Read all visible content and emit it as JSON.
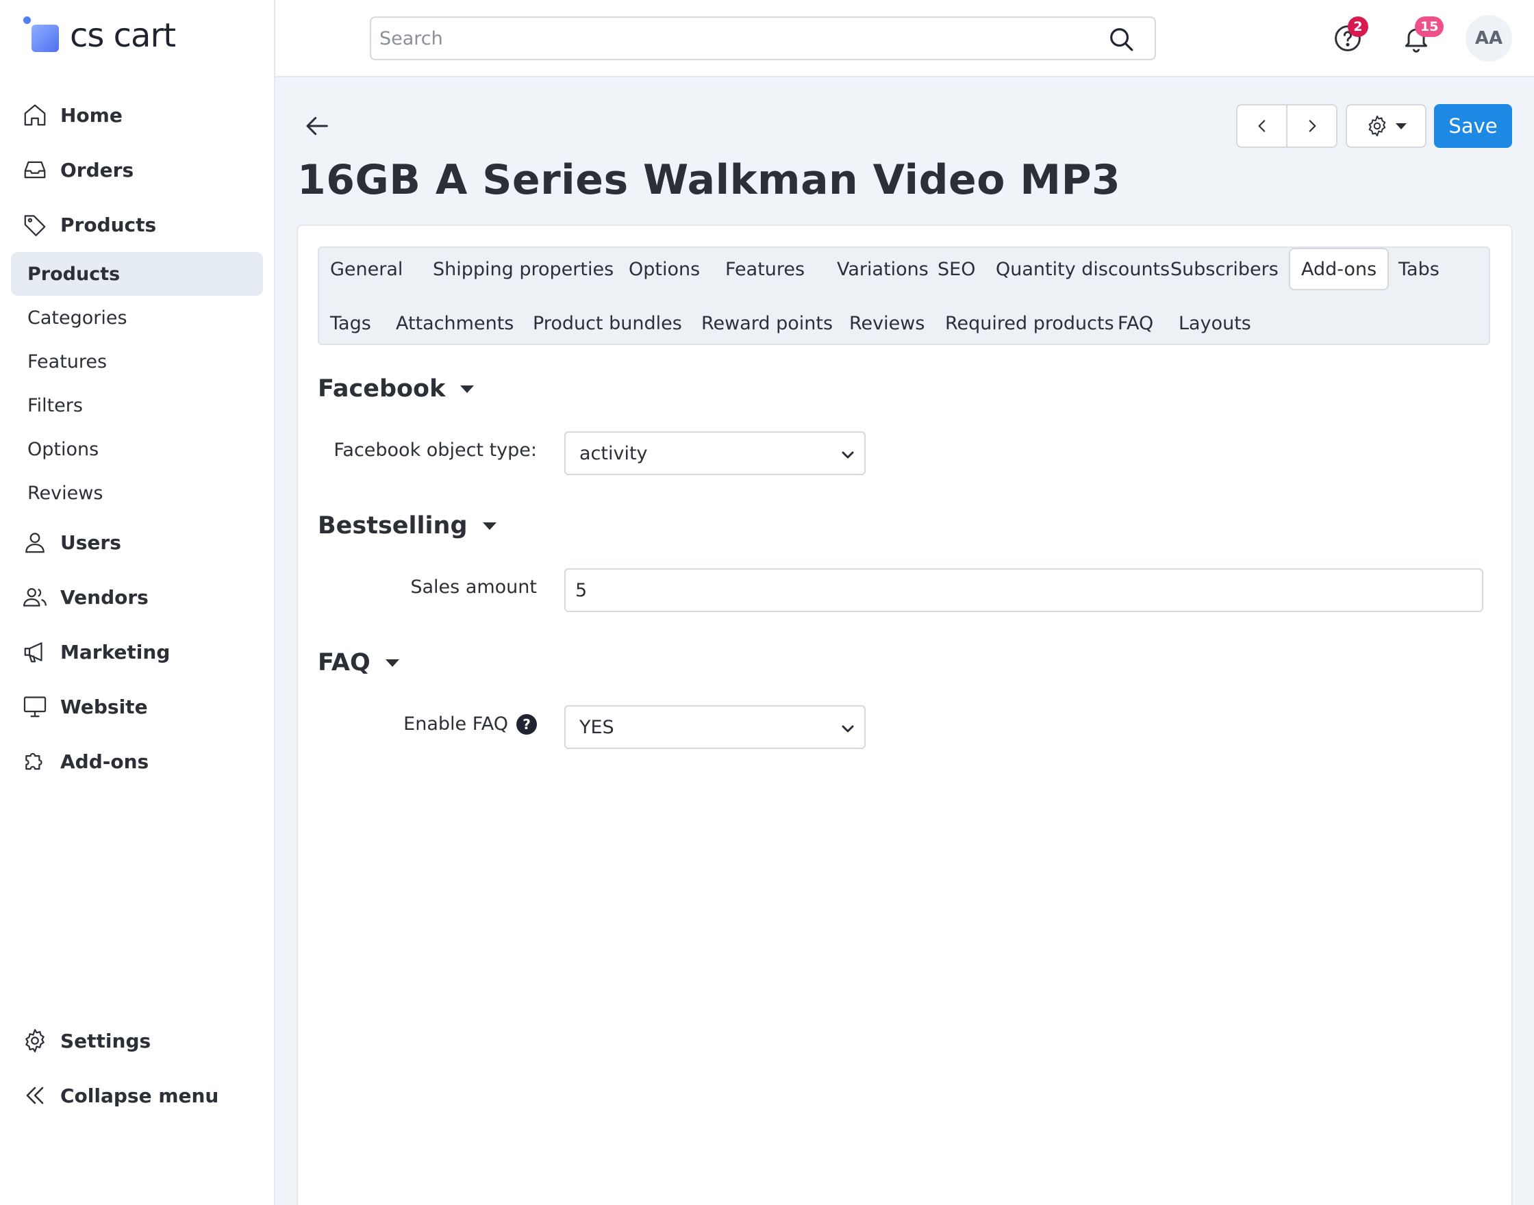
{
  "brand": {
    "name": "cs cart"
  },
  "sidebar": {
    "items": [
      {
        "label": "Home",
        "icon": "home-icon"
      },
      {
        "label": "Orders",
        "icon": "inbox-icon"
      },
      {
        "label": "Products",
        "icon": "tag-icon"
      },
      {
        "label": "Users",
        "icon": "user-icon"
      },
      {
        "label": "Vendors",
        "icon": "users-icon"
      },
      {
        "label": "Marketing",
        "icon": "megaphone-icon"
      },
      {
        "label": "Website",
        "icon": "monitor-icon"
      },
      {
        "label": "Add-ons",
        "icon": "puzzle-icon"
      }
    ],
    "products_sub": [
      "Products",
      "Categories",
      "Features",
      "Filters",
      "Options",
      "Reviews"
    ],
    "active_sub": "Products",
    "footer": [
      {
        "label": "Settings",
        "icon": "gear-icon"
      },
      {
        "label": "Collapse menu",
        "icon": "double-chevron-left-icon"
      }
    ]
  },
  "header": {
    "search_placeholder": "Search",
    "help_badge": "2",
    "notifications_badge": "15",
    "avatar_initials": "AA"
  },
  "toolbar": {
    "save_label": "Save"
  },
  "page": {
    "title": "16GB A Series Walkman Video MP3"
  },
  "tabs": {
    "row1": [
      "General",
      "Shipping properties",
      "Options",
      "Features",
      "Variations",
      "SEO",
      "Quantity discounts",
      "Subscribers",
      "Add-ons",
      "Tabs"
    ],
    "row2": [
      "Tags",
      "Attachments",
      "Product bundles",
      "Reward points",
      "Reviews",
      "Required products",
      "FAQ",
      "Layouts"
    ],
    "active": "Add-ons"
  },
  "sections": {
    "facebook": {
      "title": "Facebook",
      "label": "Facebook object type:",
      "value": "activity"
    },
    "bestselling": {
      "title": "Bestselling",
      "label": "Sales amount",
      "value": "5"
    },
    "faq": {
      "title": "FAQ",
      "label": "Enable FAQ",
      "value": "YES"
    }
  },
  "colors": {
    "accent": "#1e88e5",
    "badge_help": "#d81b4f",
    "badge_notifications": "#f0508a",
    "sidebar_active": "#e6ecf4",
    "page_bg": "#f0f3f8"
  }
}
